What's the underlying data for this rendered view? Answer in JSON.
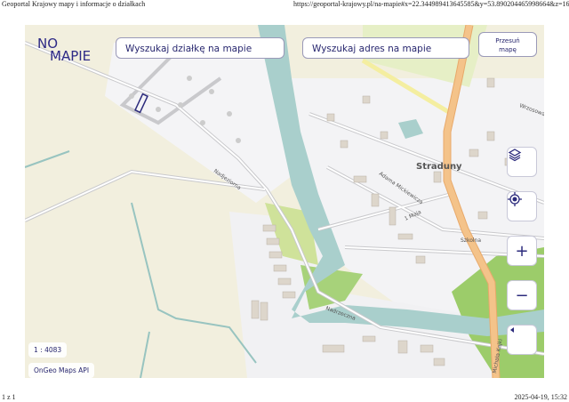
{
  "print_header": {
    "title": "Geoportal Krajowy mapy i informacje o działkach",
    "url": "https://geoportal-krajowy.pl/na-mapie#x=22.344989413645585&y=53.890204465998664&z=16.3&g..."
  },
  "print_footer": {
    "page": "1 z 1",
    "datetime": "2025-04-19, 15:32"
  },
  "logo": {
    "line1": "NO",
    "line2": "MAPIE"
  },
  "search": {
    "parcel_placeholder": "Wyszukaj działkę na mapie",
    "address_placeholder": "Wyszukaj adres na mapie"
  },
  "pan_button": {
    "line1": "Przesuń",
    "line2": "mapę"
  },
  "controls": {
    "zoom_in": "+",
    "zoom_out": "−"
  },
  "scale": "1 : 4083",
  "attribution": "OnGeo Maps API",
  "map_labels": {
    "town": "Straduny",
    "streets": [
      "Nadjeziorna",
      "Adama Mickiewicza",
      "1 Maja",
      "Szkolna",
      "Nadrzeczna",
      "Michała Kajki",
      "Wrzosowa"
    ]
  },
  "colors": {
    "accent": "#2b2a7c",
    "water": "#a9cfcc",
    "main_road": "#f4c38a",
    "green": "#9ccc6a"
  }
}
